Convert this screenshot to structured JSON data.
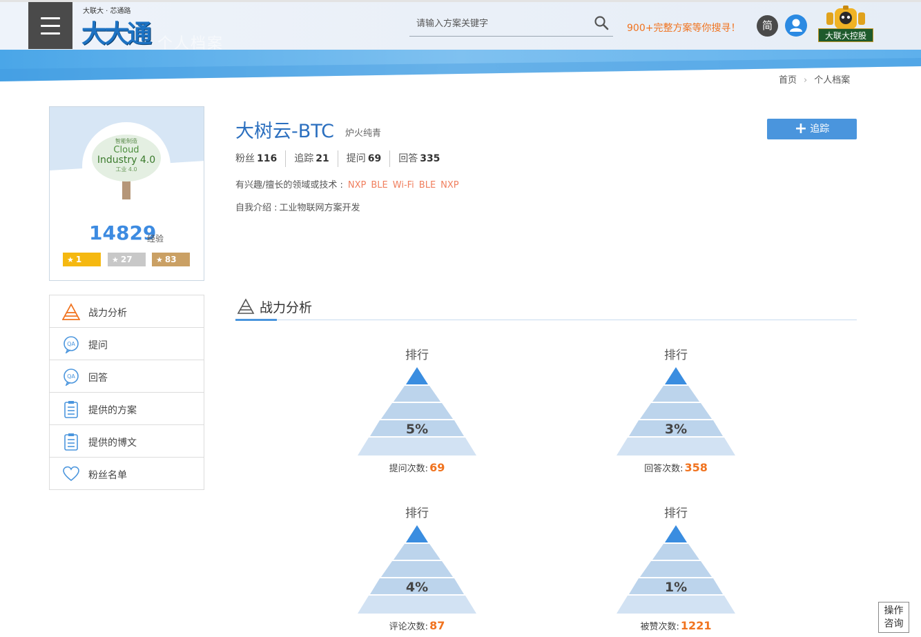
{
  "header": {
    "logo_small": "大联大 · 芯通路",
    "logo_big": "大大通",
    "ghost_title": "个人档案",
    "search_placeholder": "请输入方案关键字",
    "promo": "900+完整方案等你搜寻！",
    "lang": "简",
    "corp_label": "大联大控股"
  },
  "breadcrumb": {
    "home": "首页",
    "sep": "›",
    "current": "个人档案"
  },
  "profile": {
    "exp": "14829",
    "exp_label": "经验",
    "badges": {
      "gold": "1",
      "silver": "27",
      "bronze": "83"
    }
  },
  "side_menu": [
    {
      "label": "战力分析",
      "icon": "pyramid-icon"
    },
    {
      "label": "提问",
      "icon": "qa-bubble-icon"
    },
    {
      "label": "回答",
      "icon": "qa-bubble-icon"
    },
    {
      "label": "提供的方案",
      "icon": "clipboard-icon"
    },
    {
      "label": "提供的博文",
      "icon": "clipboard-icon"
    },
    {
      "label": "粉丝名单",
      "icon": "heart-icon"
    }
  ],
  "user": {
    "name": "大树云-BTC",
    "title": "炉火纯青",
    "follow_label": "追踪",
    "stats": [
      {
        "label": "粉丝",
        "value": "116"
      },
      {
        "label": "追踪",
        "value": "21"
      },
      {
        "label": "提问",
        "value": "69"
      },
      {
        "label": "回答",
        "value": "335"
      }
    ],
    "interests_label": "有兴趣/擅长的领域或技术 :",
    "interests": [
      "NXP",
      "BLE",
      "Wi-Fi",
      "BLE",
      "NXP"
    ],
    "intro_label": "自我介绍 :",
    "intro": "工业物联网方案开发"
  },
  "section": {
    "title": "战力分析"
  },
  "rankings": [
    {
      "label": "排行",
      "pct": "5%",
      "count_label": "提问次数:",
      "count": "69"
    },
    {
      "label": "排行",
      "pct": "3%",
      "count_label": "回答次数:",
      "count": "358"
    },
    {
      "label": "排行",
      "pct": "4%",
      "count_label": "评论次数:",
      "count": "87"
    },
    {
      "label": "排行",
      "pct": "1%",
      "count_label": "被赞次数:",
      "count": "1221"
    }
  ],
  "help": {
    "line1": "操作",
    "line2": "咨询"
  },
  "colors": {
    "accent": "#4a95dd",
    "highlight": "#f0731f",
    "name": "#2b6fbf"
  }
}
